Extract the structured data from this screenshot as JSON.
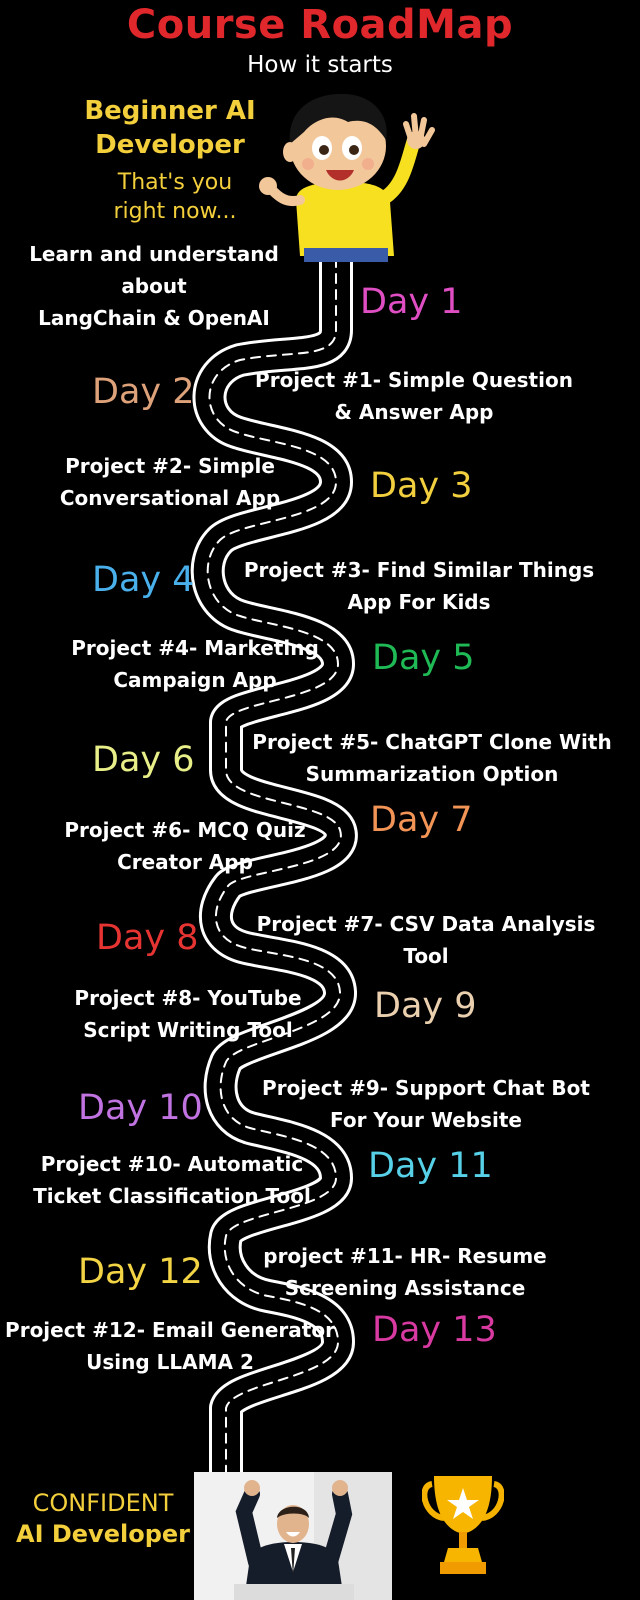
{
  "header": {
    "title": "Course RoadMap",
    "subtitle": "How it starts"
  },
  "start": {
    "line1": "Beginner AI",
    "line2": "Developer",
    "note1": "That's you",
    "note2": "right now..."
  },
  "steps": [
    {
      "day": "Day 1",
      "day_color": "#e04ec4",
      "project_lines": [
        "Learn and understand",
        "about",
        "LangChain & OpenAI"
      ]
    },
    {
      "day": "Day 2",
      "day_color": "#dea27a",
      "project_lines": [
        "Project #1- Simple Question",
        "& Answer App"
      ]
    },
    {
      "day": "Day 3",
      "day_color": "#f1cf3f",
      "project_lines": [
        "Project #2- Simple",
        "Conversational App"
      ]
    },
    {
      "day": "Day 4",
      "day_color": "#4ab0ec",
      "project_lines": [
        "Project #3- Find Similar Things",
        "App For Kids"
      ]
    },
    {
      "day": "Day 5",
      "day_color": "#1fb955",
      "project_lines": [
        "Project #4- Marketing",
        "Campaign App"
      ]
    },
    {
      "day": "Day 6",
      "day_color": "#e8ee88",
      "project_lines": [
        "Project #5- ChatGPT Clone With",
        "Summarization Option"
      ]
    },
    {
      "day": "Day 7",
      "day_color": "#f39457",
      "project_lines": [
        "Project #6- MCQ Quiz",
        "Creator App"
      ]
    },
    {
      "day": "Day 8",
      "day_color": "#e63432",
      "project_lines": [
        "Project #7- CSV Data Analysis",
        "Tool"
      ]
    },
    {
      "day": "Day 9",
      "day_color": "#ebd0b0",
      "project_lines": [
        "Project #8- YouTube",
        "Script Writing Tool"
      ]
    },
    {
      "day": "Day 10",
      "day_color": "#c173e2",
      "project_lines": [
        "Project #9- Support Chat Bot",
        "For Your Website"
      ]
    },
    {
      "day": "Day 11",
      "day_color": "#57d1e8",
      "project_lines": [
        "Project #10- Automatic",
        "Ticket Classification Tool"
      ]
    },
    {
      "day": "Day 12",
      "day_color": "#f2d445",
      "project_lines": [
        "project #11- HR- Resume",
        "Screening Assistance"
      ]
    },
    {
      "day": "Day 13",
      "day_color": "#d93aa2",
      "project_lines": [
        "Project #12- Email Generator",
        "Using LLAMA 2"
      ]
    }
  ],
  "finish": {
    "line1": "CONFIDENT",
    "line2": "AI Developer"
  },
  "icons": {
    "kid": "waving-boy-illustration",
    "road": "winding-road",
    "photo": "celebrating-businessman-photo",
    "trophy": "trophy-icon"
  }
}
